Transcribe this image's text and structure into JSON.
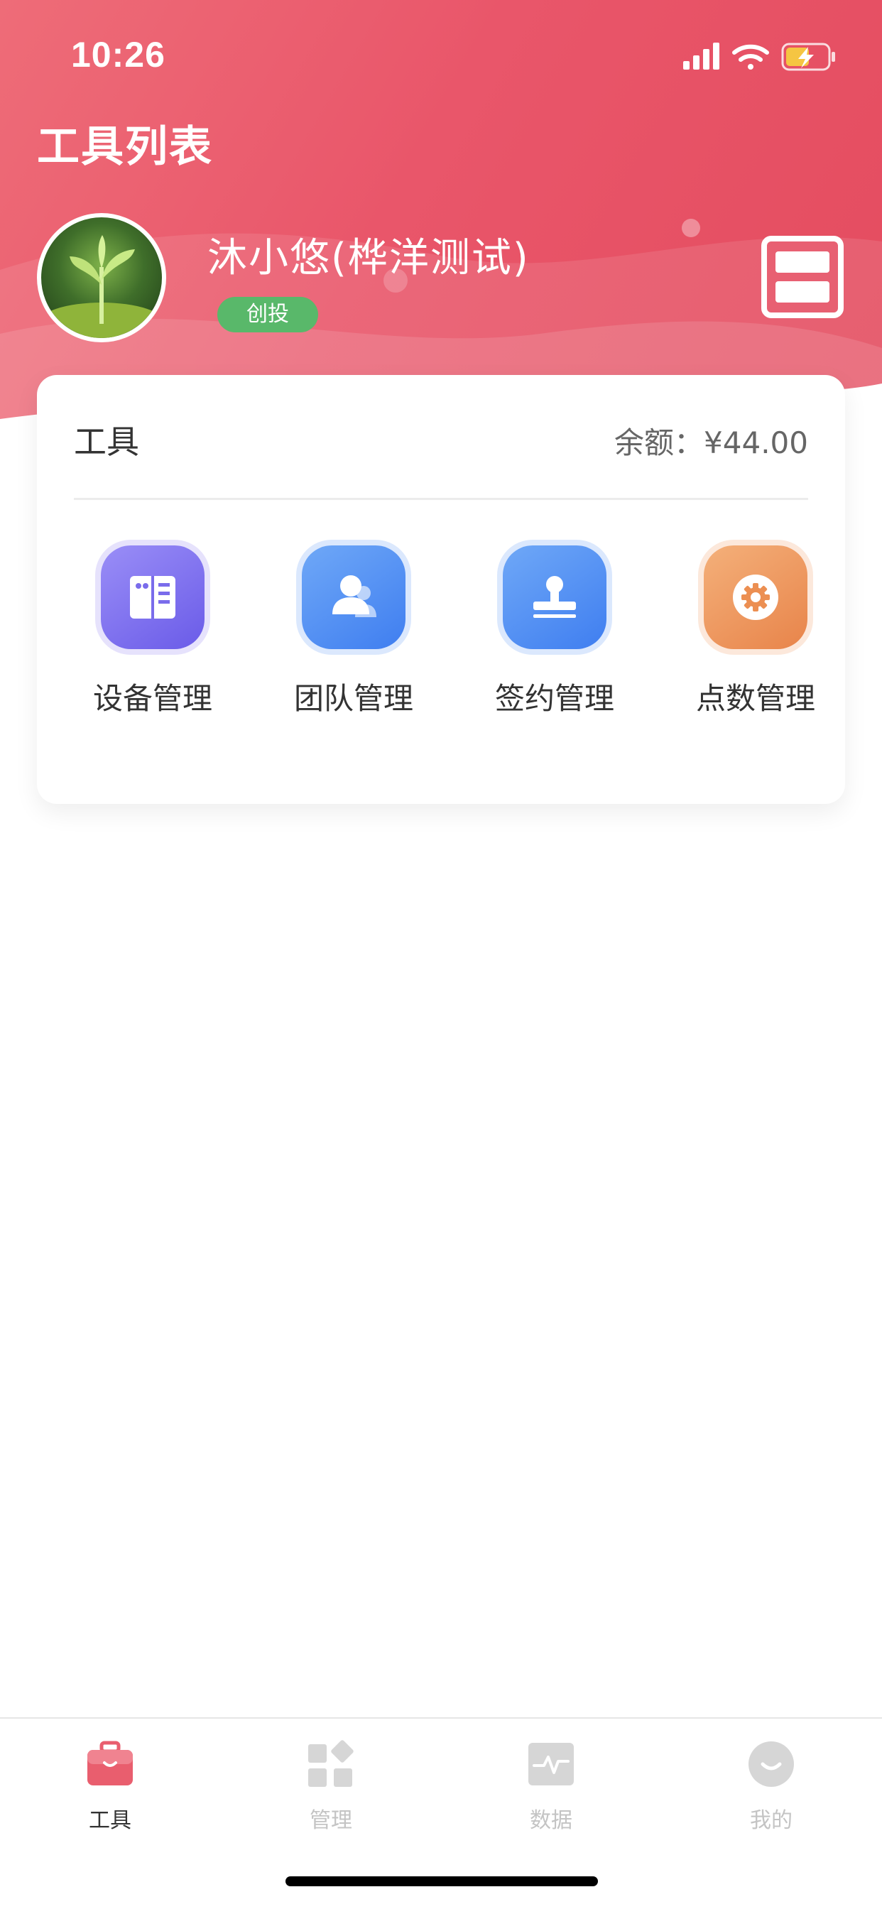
{
  "status_bar": {
    "time": "10:26",
    "icons": [
      "cellular-signal-icon",
      "wifi-icon",
      "battery-charging-icon"
    ]
  },
  "header": {
    "title": "工具列表"
  },
  "profile": {
    "name": "沐小悠(桦洋测试)",
    "role_badge": "创投",
    "scan_icon": "scan-icon"
  },
  "tools_card": {
    "title": "工具",
    "balance": "余额：¥44.00",
    "tools": [
      {
        "label": "设备管理",
        "icon": "device-card-icon",
        "color": "#7b6cf0"
      },
      {
        "label": "团队管理",
        "icon": "team-user-icon",
        "color": "#4f8ff2"
      },
      {
        "label": "签约管理",
        "icon": "stamp-icon",
        "color": "#4f8ff2"
      },
      {
        "label": "点数管理",
        "icon": "gear-icon",
        "color": "#ef9a5a"
      }
    ]
  },
  "tab_bar": {
    "tabs": [
      {
        "label": "工具",
        "icon": "toolbox-icon",
        "active": true
      },
      {
        "label": "管理",
        "icon": "grid-manage-icon",
        "active": false
      },
      {
        "label": "数据",
        "icon": "pulse-chart-icon",
        "active": false
      },
      {
        "label": "我的",
        "icon": "smile-face-icon",
        "active": false
      }
    ]
  },
  "colors": {
    "header_primary": "#e9566a",
    "badge_green": "#59b86a",
    "active_tab": "#e95e6e",
    "inactive_tab": "#d0d0d0"
  }
}
